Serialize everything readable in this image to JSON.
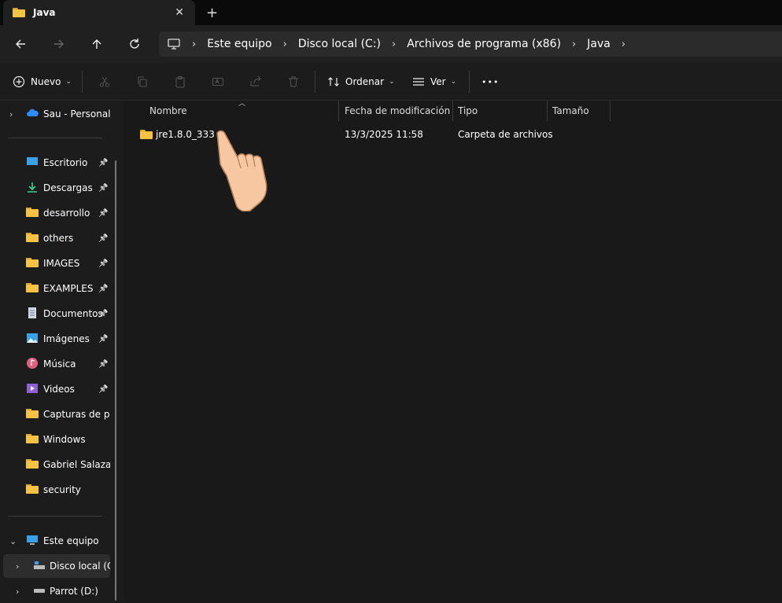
{
  "tab": {
    "title": "Java",
    "close": "✕",
    "new": "+"
  },
  "address": {
    "crumbs": [
      "Este equipo",
      "Disco local (C:)",
      "Archivos de programa (x86)",
      "Java"
    ],
    "separator": "›"
  },
  "toolbar": {
    "new_label": "Nuevo",
    "sort_label": "Ordenar",
    "view_label": "Ver",
    "more_label": "•••"
  },
  "columns": {
    "name": "Nombre",
    "modified": "Fecha de modificación",
    "type": "Tipo",
    "size": "Tamaño"
  },
  "files": [
    {
      "name": "jre1.8.0_333",
      "modified": "13/3/2025 11:58",
      "type": "Carpeta de archivos",
      "size": ""
    }
  ],
  "sidebar": {
    "top": {
      "label": "Sau - Personal",
      "icon": "onedrive-cloud-icon"
    },
    "quick": [
      {
        "label": "Escritorio",
        "icon": "desktop-icon"
      },
      {
        "label": "Descargas",
        "icon": "download-arrow-icon"
      },
      {
        "label": "desarrollo",
        "icon": "folder-icon"
      },
      {
        "label": "others",
        "icon": "folder-icon"
      },
      {
        "label": "IMAGES",
        "icon": "folder-icon"
      },
      {
        "label": "EXAMPLES",
        "icon": "folder-icon"
      },
      {
        "label": "Documentos",
        "icon": "document-icon"
      },
      {
        "label": "Imágenes",
        "icon": "pictures-icon"
      },
      {
        "label": "Música",
        "icon": "music-icon"
      },
      {
        "label": "Videos",
        "icon": "video-icon"
      },
      {
        "label": "Capturas de pan",
        "icon": "folder-icon"
      },
      {
        "label": "Windows",
        "icon": "folder-icon"
      },
      {
        "label": "Gabriel Salazar_f",
        "icon": "folder-icon"
      },
      {
        "label": "security",
        "icon": "folder-icon"
      }
    ],
    "pc": {
      "label": "Este equipo",
      "icon": "monitor-icon"
    },
    "drives": [
      {
        "label": "Disco local (C:)",
        "icon": "drive-icon"
      },
      {
        "label": "Parrot (D:)",
        "icon": "drive-icon"
      }
    ]
  },
  "colors": {
    "folder": "#f5c243",
    "background": "#191919",
    "accent": "#4cc2ff"
  }
}
